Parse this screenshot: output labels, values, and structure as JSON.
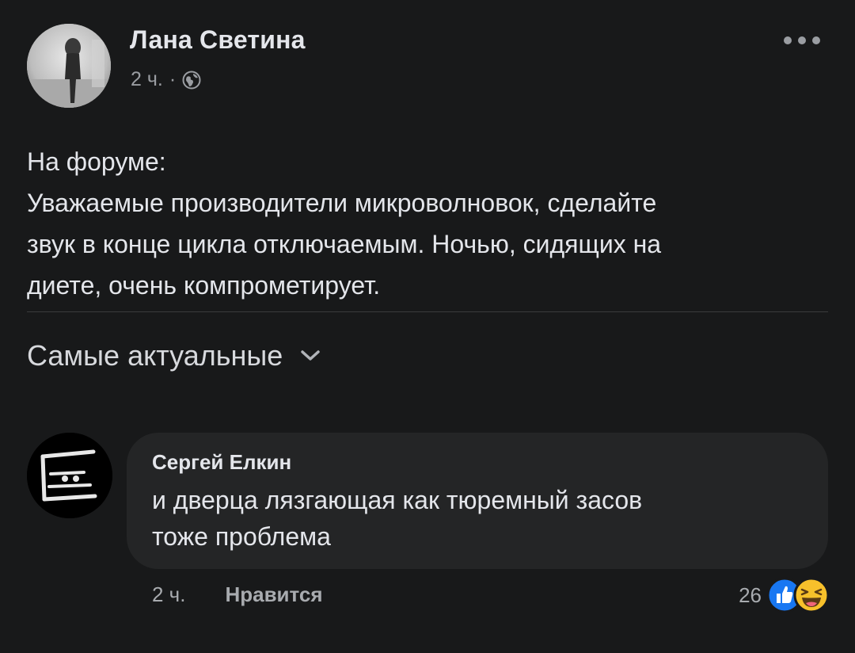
{
  "post": {
    "author": "Лана Светина",
    "time": "2 ч.",
    "separator": "·",
    "privacy_icon": "globe-icon",
    "more_icon": "more-options-icon",
    "body_lines": [
      "На форуме:",
      "Уважаемые производители микроволновок, сделайте",
      "звук в конце цикла отключаемым. Ночью, сидящих на",
      "диете, очень компрометирует."
    ]
  },
  "comments_sort": {
    "label": "Самые актуальные",
    "icon": "chevron-down-icon"
  },
  "comment": {
    "author": "Сергей Елкин",
    "text_lines": [
      "и дверца лязгающая как тюремный засов",
      "тоже проблема"
    ],
    "time": "2 ч.",
    "like_label": "Нравится",
    "reaction_count": "26",
    "reaction_icons": [
      "like-reaction-icon",
      "haha-reaction-icon"
    ]
  },
  "colors": {
    "background": "#18191a",
    "bubble": "#242526",
    "text": "#e4e6eb",
    "secondary_text": "#9a9da2",
    "like_blue": "#1877f2",
    "haha_yellow": "#f7c02b"
  }
}
